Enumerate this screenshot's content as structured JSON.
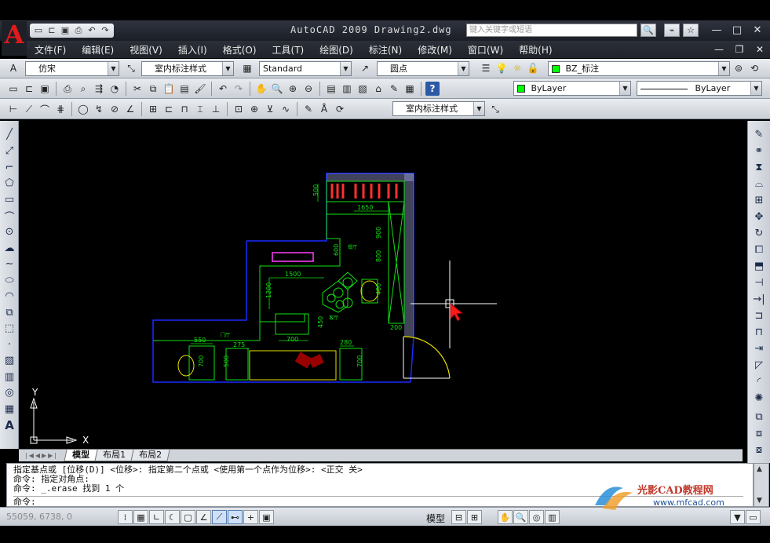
{
  "app": {
    "title": "AutoCAD 2009  Drawing2.dwg",
    "search_placeholder": "键入关键字或短语",
    "logo_letter": "A"
  },
  "menu": [
    "文件(F)",
    "编辑(E)",
    "视图(V)",
    "插入(I)",
    "格式(O)",
    "工具(T)",
    "绘图(D)",
    "标注(N)",
    "修改(M)",
    "窗口(W)",
    "帮助(H)"
  ],
  "styles_bar": {
    "text_style": "仿宋",
    "dim_style": "室内标注样式",
    "table_style": "Standard",
    "multileader_style": "圆点",
    "layer": "BZ_标注"
  },
  "properties_bar": {
    "color": "ByLayer",
    "linetype": "ByLayer"
  },
  "dim_toolbar": {
    "dim_style": "室内标注样式"
  },
  "tabs": [
    {
      "label": "模型",
      "active": true
    },
    {
      "label": "布局1",
      "active": false
    },
    {
      "label": "布局2",
      "active": false
    }
  ],
  "command": {
    "lines": [
      "指定基点或 [位移(D)] <位移>:  指定第二个点或 <使用第一个点作为位移>:  <正交 关>",
      "命令: 指定对角点:",
      "命令: _.erase 找到 1 个"
    ],
    "prompt": "命令:"
  },
  "status": {
    "coords": "55059, 6738, 0",
    "model": "模型"
  },
  "ucs": {
    "x": "X",
    "y": "Y"
  },
  "drawing_labels": {
    "d500_top": "500",
    "d1650": "1650",
    "d900": "900",
    "d800": "800",
    "d600": "600",
    "d1500": "1500",
    "d1200": "1200",
    "d400": "400",
    "d700_mid": "700",
    "d450": "450",
    "d200": "200",
    "d550": "550",
    "d275": "275",
    "d280": "280",
    "d700_a": "700",
    "d500_b": "500",
    "d700_c": "700",
    "room_dining": "餐厅",
    "room_living": "客厅",
    "room_hall": "门厅"
  },
  "watermark": {
    "brand": "光影CAD教程网",
    "url": "www.mfcad.com"
  }
}
